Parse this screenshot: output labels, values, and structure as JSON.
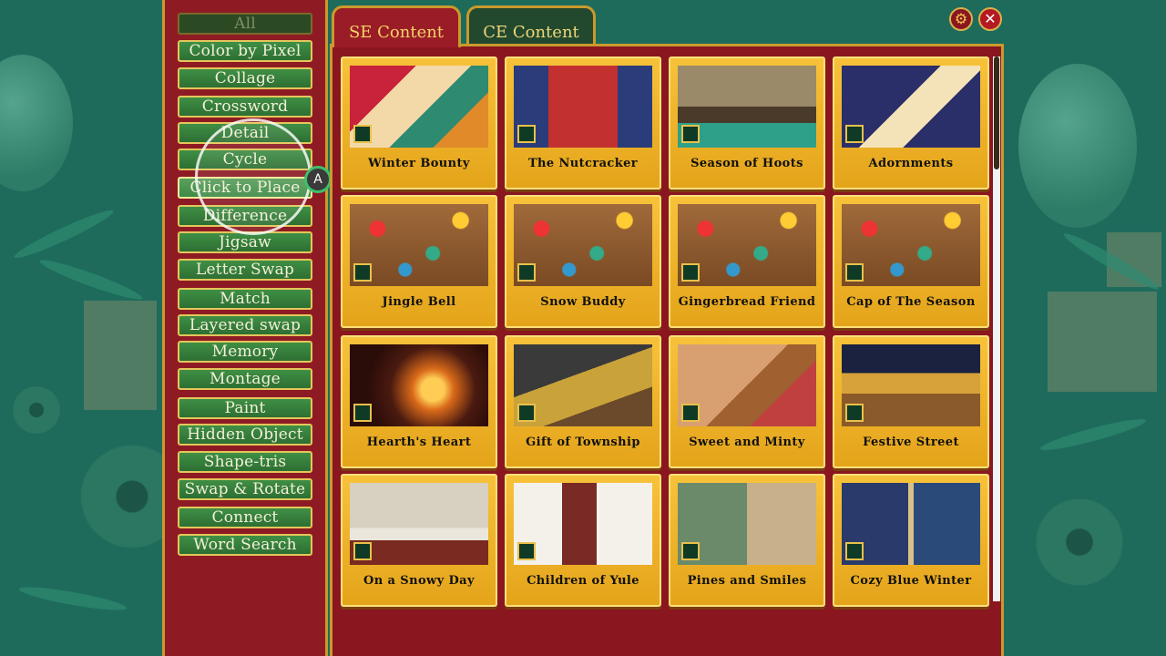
{
  "categories": [
    "All",
    "Color by Pixel",
    "Collage",
    "Crossword",
    "Detail",
    "Cycle",
    "Click to Place",
    "Difference",
    "Jigsaw",
    "Letter Swap",
    "Match",
    "Layered swap",
    "Memory",
    "Montage",
    "Paint",
    "Hidden Object",
    "Shape-tris",
    "Swap & Rotate",
    "Connect",
    "Word Search"
  ],
  "selected_category": "All",
  "focused_category": "Click to Place",
  "controller_button": "A",
  "tabs": [
    {
      "label": "SE Content",
      "active": true
    },
    {
      "label": "CE Content",
      "active": false
    }
  ],
  "toolbar": {
    "settings_icon": "gear-icon",
    "close_icon": "close-icon"
  },
  "puzzles": [
    {
      "title": "Winter Bounty",
      "theme": "illustration"
    },
    {
      "title": "The Nutcracker",
      "theme": "illustration"
    },
    {
      "title": "Season of Hoots",
      "theme": "illustration"
    },
    {
      "title": "Adornments",
      "theme": "illustration"
    },
    {
      "title": "Jingle Bell",
      "theme": "stickers"
    },
    {
      "title": "Snow Buddy",
      "theme": "stickers"
    },
    {
      "title": "Gingerbread Friend",
      "theme": "stickers"
    },
    {
      "title": "Cap of The Season",
      "theme": "stickers"
    },
    {
      "title": "Hearth's Heart",
      "theme": "photo"
    },
    {
      "title": "Gift of Township",
      "theme": "photo"
    },
    {
      "title": "Sweet and Minty",
      "theme": "photo"
    },
    {
      "title": "Festive Street",
      "theme": "photo"
    },
    {
      "title": "On a Snowy Day",
      "theme": "vintage"
    },
    {
      "title": "Children of Yule",
      "theme": "vintage"
    },
    {
      "title": "Pines and Smiles",
      "theme": "vintage"
    },
    {
      "title": "Cozy Blue Winter",
      "theme": "vintage"
    }
  ],
  "colors": {
    "panel_red": "#8a1620",
    "card_gold": "#f2b52e",
    "button_green": "#3f8f45",
    "accent_gold": "#c99a2c"
  }
}
